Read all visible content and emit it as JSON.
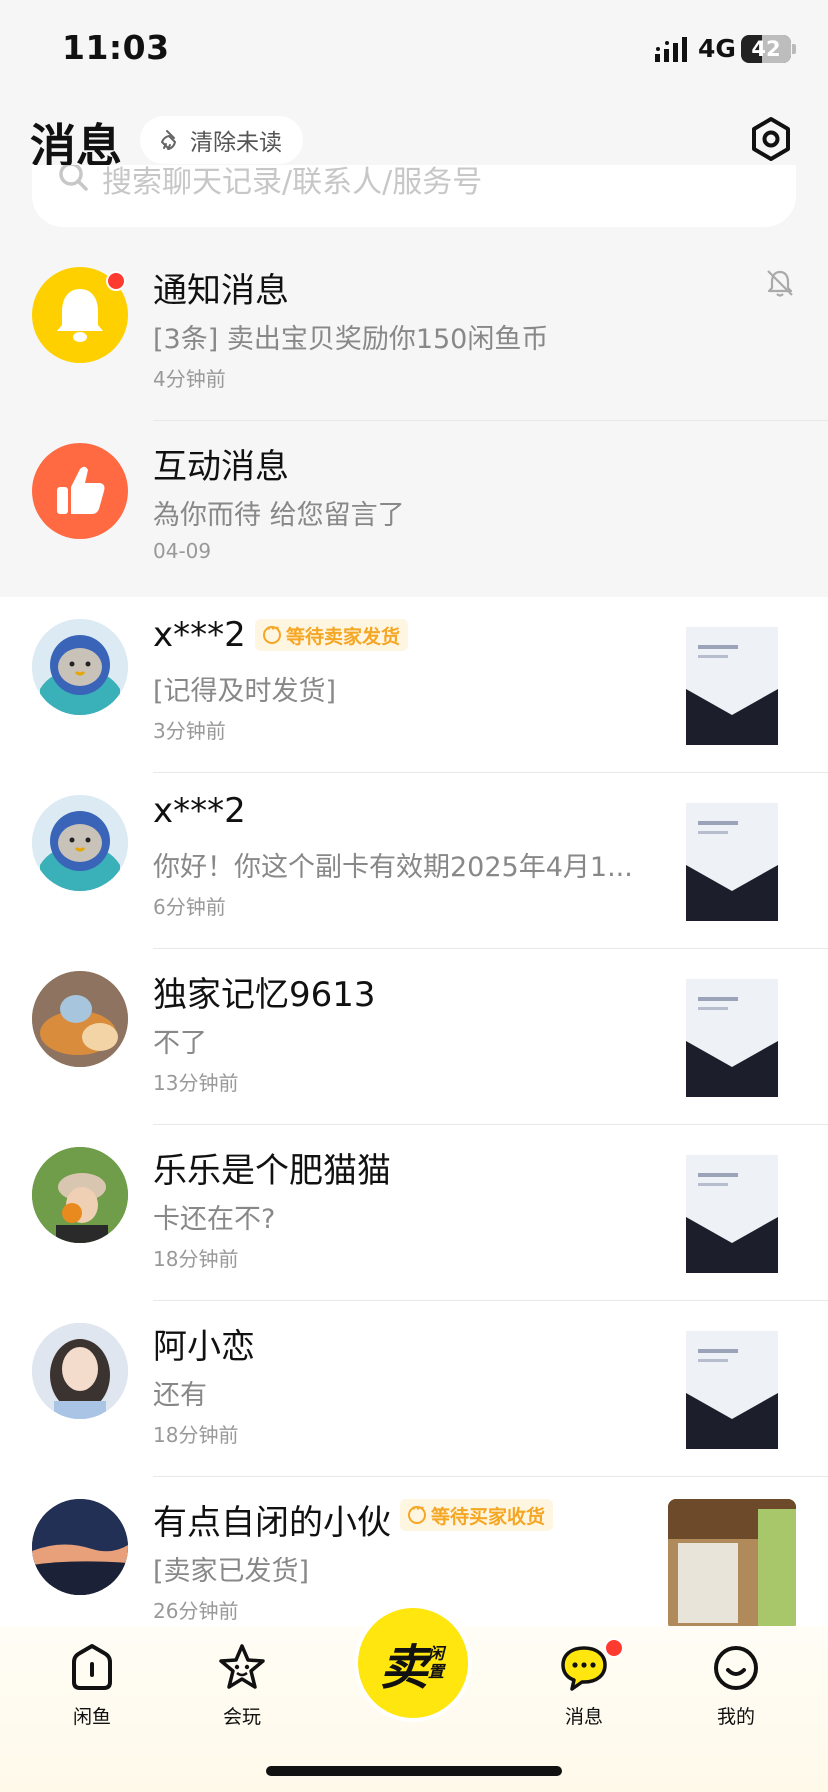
{
  "status_bar": {
    "time": "11:03",
    "network": "4G",
    "battery": "42",
    "battery_level": 0.42
  },
  "header": {
    "title": "消息",
    "clear_label": "清除未读"
  },
  "search": {
    "placeholder": "搜索聊天记录/联系人/服务号"
  },
  "system_rows": [
    {
      "name": "通知消息",
      "message": "[3条] 卖出宝贝奖励你150闲鱼币",
      "time": "4分钟前",
      "icon": "bell-icon",
      "color": "#ffd000",
      "unread": true,
      "muted": true
    },
    {
      "name": "互动消息",
      "message": "為你而待 给您留言了",
      "time": "04-09",
      "icon": "thumbs-up-icon",
      "color": "#ff6a42"
    }
  ],
  "conversations": [
    {
      "name": "x***2",
      "badge": "等待卖家发货",
      "message": "[记得及时发货]",
      "time": "3分钟前"
    },
    {
      "name": "x***2",
      "message": "你好！你这个副卡有效期2025年4月1...",
      "time": "6分钟前"
    },
    {
      "name": "独家记忆9613",
      "message": "不了",
      "time": "13分钟前"
    },
    {
      "name": "乐乐是个肥猫猫",
      "message": "卡还在不?",
      "time": "18分钟前"
    },
    {
      "name": "阿小恋",
      "message": "还有",
      "time": "18分钟前"
    },
    {
      "name": "有点自闭的小伙",
      "badge": "等待买家收货",
      "message": "[卖家已发货]",
      "time": "26分钟前"
    }
  ],
  "tabbar": {
    "tabs": [
      {
        "label": "闲鱼",
        "icon": "home-icon"
      },
      {
        "label": "会玩",
        "icon": "star-face-icon"
      },
      {
        "label": "消息",
        "icon": "chat-bubble-icon",
        "unread": true
      },
      {
        "label": "我的",
        "icon": "smile-face-icon"
      }
    ],
    "sell": {
      "big": "卖",
      "small": "闲置"
    }
  },
  "colors": {
    "accent_yellow": "#ffe60f",
    "badge_orange": "#f5a623",
    "unread_red": "#ff3b30"
  }
}
